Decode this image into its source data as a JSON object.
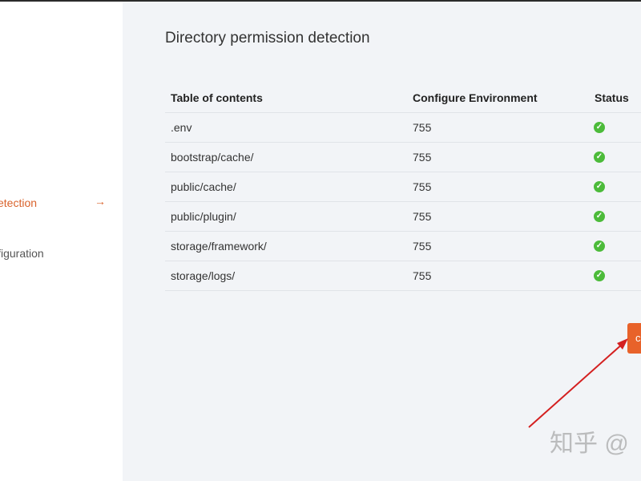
{
  "sidebar": {
    "active_item": "etection",
    "inactive_item": "ifiguration",
    "arrow_glyph": "→"
  },
  "main": {
    "title": "Directory permission detection",
    "table": {
      "headers": [
        "Table of contents",
        "Configure Environment",
        "Status"
      ],
      "rows": [
        {
          "dir": ".env",
          "perm": "755",
          "status": "ok"
        },
        {
          "dir": "bootstrap/cache/",
          "perm": "755",
          "status": "ok"
        },
        {
          "dir": "public/cache/",
          "perm": "755",
          "status": "ok"
        },
        {
          "dir": "public/plugin/",
          "perm": "755",
          "status": "ok"
        },
        {
          "dir": "storage/framework/",
          "perm": "755",
          "status": "ok"
        },
        {
          "dir": "storage/logs/",
          "perm": "755",
          "status": "ok"
        }
      ]
    },
    "next_button_label": "c"
  },
  "watermark": "知乎 @",
  "colors": {
    "accent": "#e8622a",
    "success": "#4cbb3a",
    "annotation": "#d42020"
  },
  "icons": {
    "status": "check-circle-icon"
  }
}
